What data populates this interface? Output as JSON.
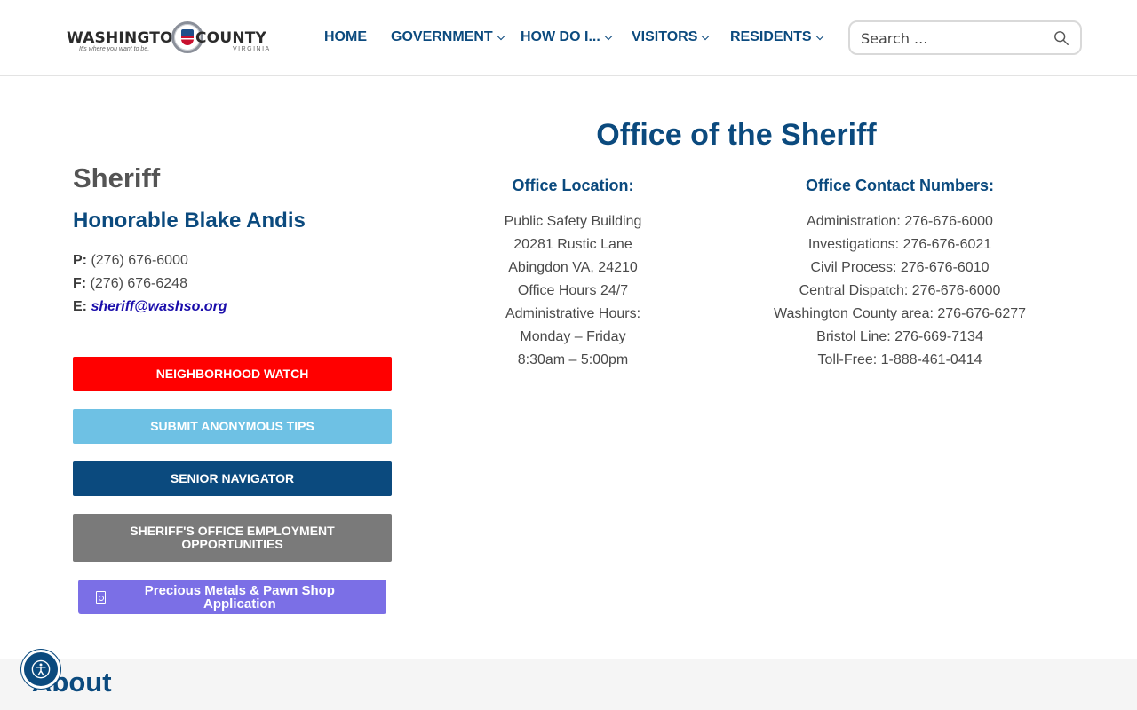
{
  "header": {
    "logo": {
      "word_left": "WASHINGTON",
      "word_right": "COUNTY",
      "tagline": "It's where you want to be.",
      "state": "VIRGINIA"
    },
    "nav": [
      {
        "label": "HOME",
        "has_dropdown": false
      },
      {
        "label": "GOVERNMENT",
        "has_dropdown": true
      },
      {
        "label": "HOW DO I...",
        "has_dropdown": true
      },
      {
        "label": "VISITORS",
        "has_dropdown": true
      },
      {
        "label": "RESIDENTS",
        "has_dropdown": true
      }
    ],
    "search": {
      "placeholder": "Search ...",
      "value": ""
    }
  },
  "sidebar": {
    "heading": "Sheriff",
    "name": "Honorable Blake Andis",
    "phone_label": "P:",
    "phone": "(276) 676-6000",
    "fax_label": "F:",
    "fax": "(276) 676-6248",
    "email_label": "E:",
    "email": "sheriff@washso.org",
    "buttons": [
      {
        "label": "NEIGHBORHOOD WATCH",
        "color": "#ff0000"
      },
      {
        "label": "SUBMIT ANONYMOUS TIPS",
        "color": "#6ec1e4"
      },
      {
        "label": "SENIOR NAVIGATOR",
        "color": "#0b4a7e"
      },
      {
        "label": "SHERIFF'S OFFICE EMPLOYMENT OPPORTUNITIES",
        "color": "#7a7a7a"
      },
      {
        "label": "Precious Metals & Pawn Shop Application",
        "color": "#7b6fe6",
        "icon": "file-pdf-icon"
      }
    ]
  },
  "main": {
    "title": "Office of the Sheriff",
    "location": {
      "heading": "Office Location:",
      "lines": [
        "Public Safety Building",
        "20281 Rustic Lane",
        "Abingdon VA, 24210",
        "Office Hours 24/7",
        "Administrative Hours:",
        "Monday – Friday",
        "8:30am – 5:00pm"
      ]
    },
    "contacts": {
      "heading": "Office Contact Numbers:",
      "lines": [
        "Administration: 276-676-6000",
        "Investigations: 276-676-6021",
        "Civil Process: 276-676-6010",
        "Central Dispatch: 276-676-6000",
        "Washington County area: 276-676-6277",
        "Bristol Line: 276-669-7134",
        "Toll-Free: 1-888-461-0414"
      ]
    }
  },
  "footer": {
    "about_title": "About"
  },
  "accessibility": {
    "icon": "accessibility-icon"
  },
  "colors": {
    "brand_blue": "#0b4a7e",
    "link": "#1a0dab"
  }
}
